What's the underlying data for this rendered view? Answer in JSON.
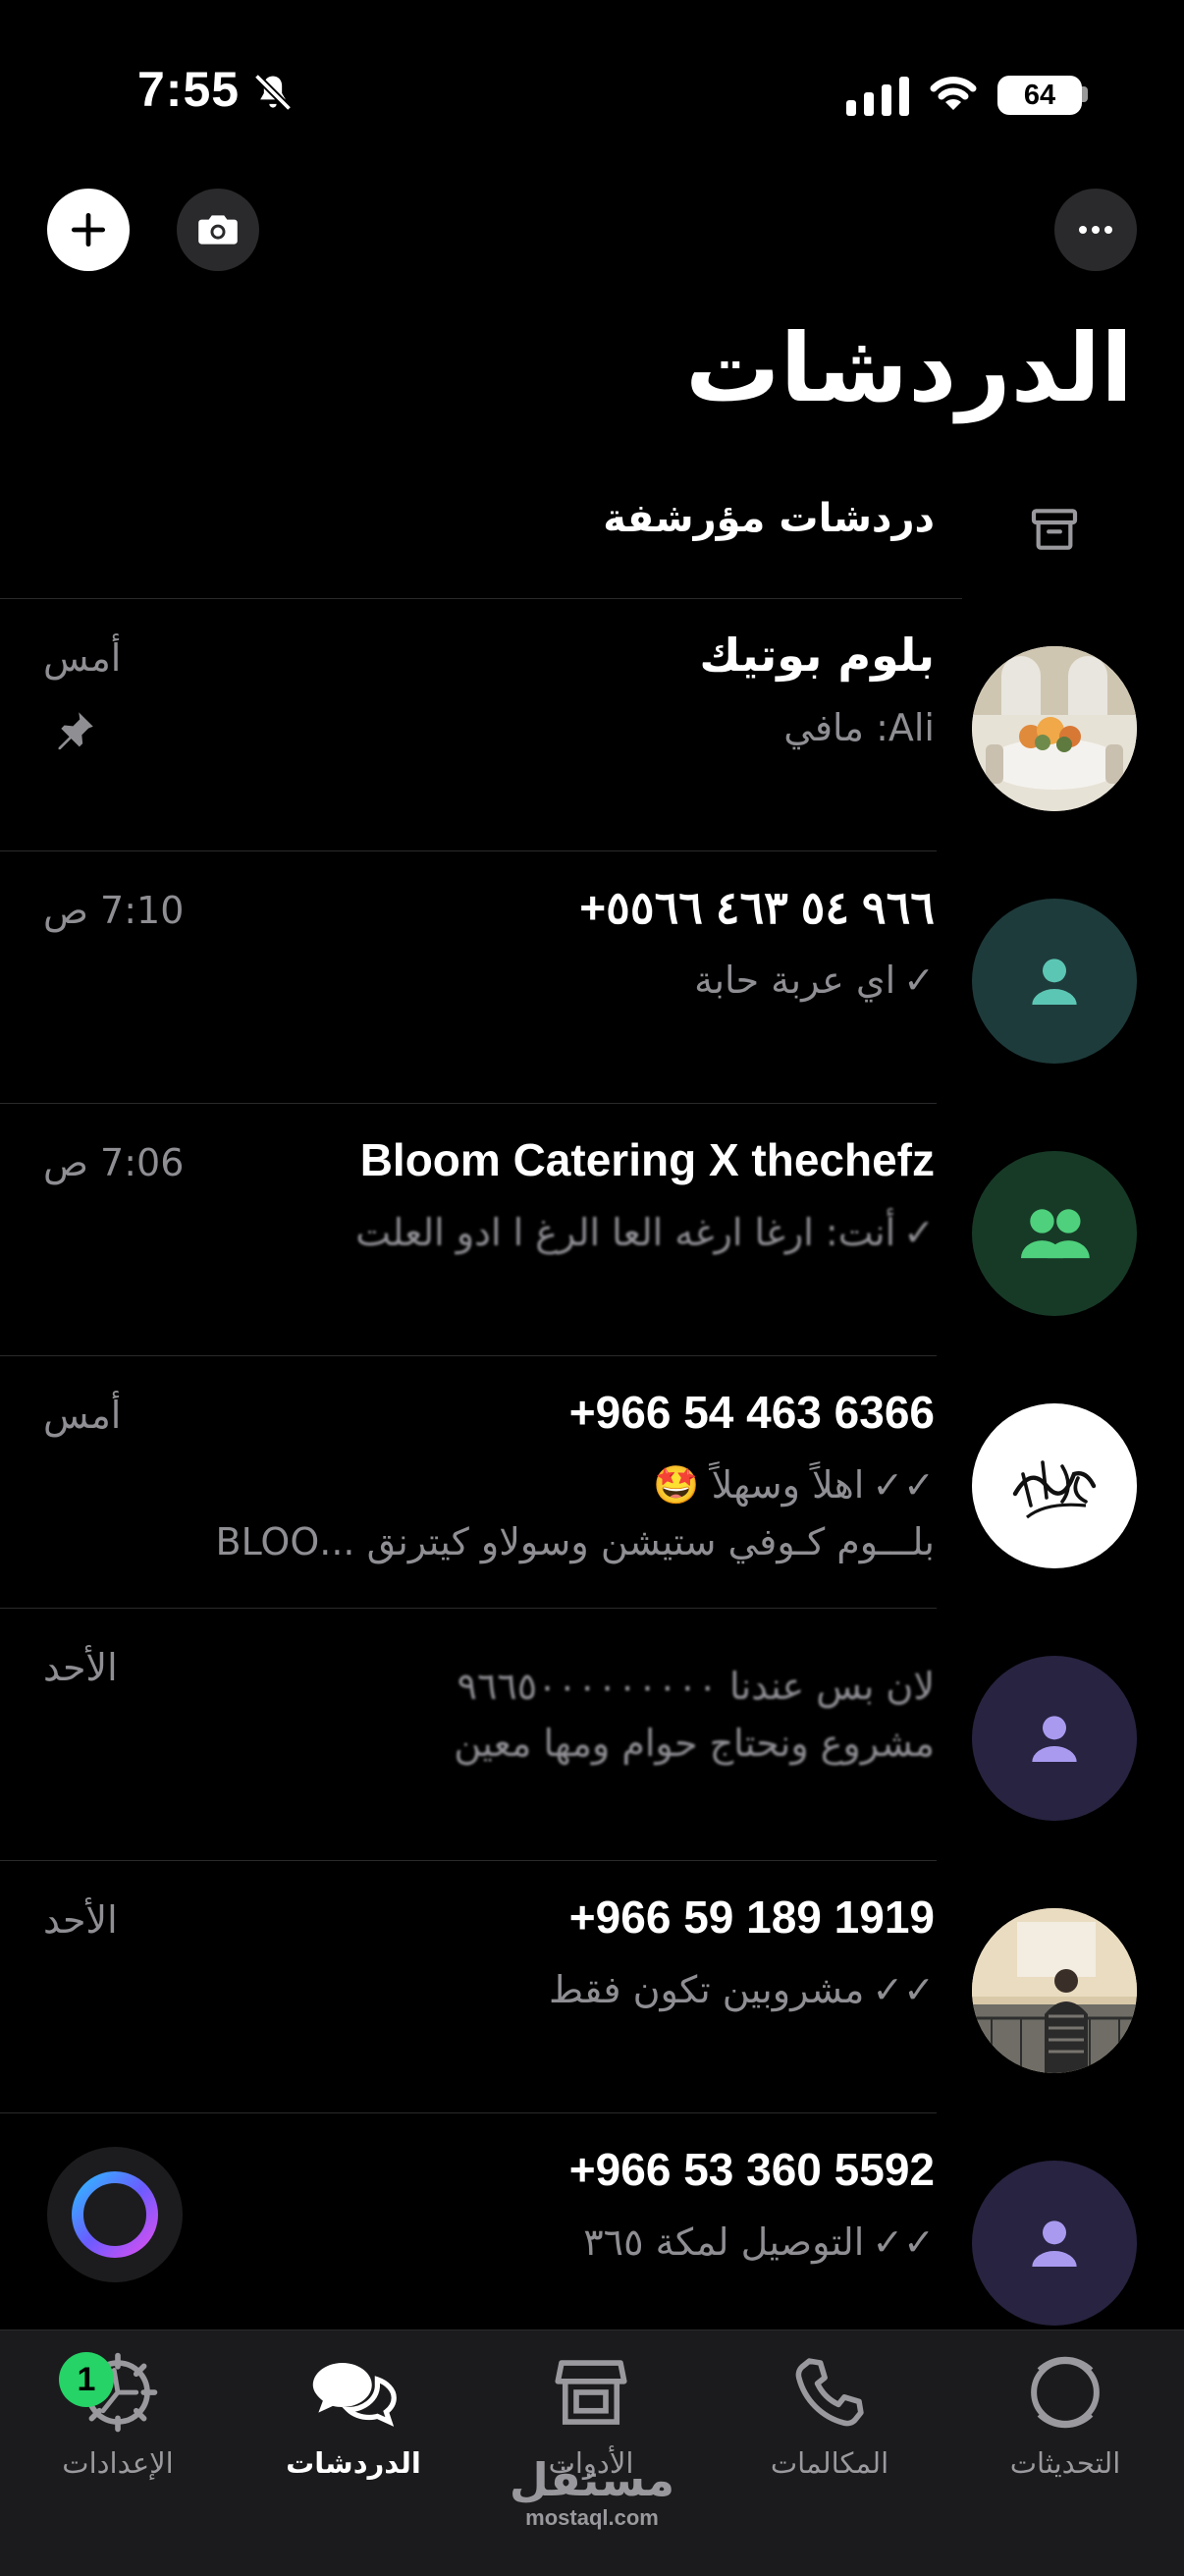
{
  "status_bar": {
    "time": "7:55",
    "battery": "64"
  },
  "header": {
    "title": "الدردشات",
    "new_chat_icon": "plus-icon",
    "camera_icon": "camera-icon",
    "more_icon": "ellipsis-icon"
  },
  "archived": {
    "label": "دردشات مؤرشفة",
    "icon": "archive-box-icon"
  },
  "chats": [
    {
      "name": "بلوم بوتيك",
      "time": "أمس",
      "preview": "Ali: مافي",
      "pinned": true,
      "avatar": "photo",
      "checks": ""
    },
    {
      "name": "+٩٦٦ ٥٤ ٤٦٣ ٥٥٦٦",
      "time": "7:10 ص",
      "preview": "اي عربة حابة",
      "avatar": "person-teal",
      "checks": "✓"
    },
    {
      "name": "Bloom Catering X thechefz",
      "time": "7:06 ص",
      "preview": "أنت: ارغا ارغه العا الرغ ا ادو العلت",
      "avatar": "group-green",
      "checks": "✓"
    },
    {
      "name": "+966 54 463 6366",
      "time": "أمس",
      "preview": "اهلاً وسهلاً 🤩",
      "preview2": "بلـــوم كـوفي ستيشن وسولاو كيترنق ...BLOO",
      "avatar": "calligraphy",
      "checks": "✓✓"
    },
    {
      "name": "",
      "time": "الأحد",
      "preview": "لان بس عندنا ٩٦٦٥٠٠٠٠٠٠٠٠٠",
      "preview2": "مشروع ونحتاج حوام ومها معين",
      "avatar": "person-purple",
      "checks": ""
    },
    {
      "name": "+966 59 189 1919",
      "time": "الأحد",
      "preview": "مشروبين تكون فقط",
      "avatar": "photo-man",
      "checks": "✓✓"
    },
    {
      "name": "+966 53 360 5592",
      "time": "",
      "preview": "التوصيل لمكة ٣٦٥",
      "avatar": "person-purple",
      "checks": "✓✓"
    }
  ],
  "tabs": [
    {
      "label": "التحديثات",
      "icon": "updates-icon"
    },
    {
      "label": "المكالمات",
      "icon": "phone-icon"
    },
    {
      "label": "الأدوات",
      "icon": "store-icon"
    },
    {
      "label": "الدردشات",
      "icon": "chats-icon"
    },
    {
      "label": "الإعدادات",
      "icon": "settings-gear-icon",
      "badge": "1"
    }
  ],
  "watermark": {
    "arabic": "مستقل",
    "latin": "mostaql.com"
  },
  "colors": {
    "background": "#000000",
    "tab_bar": "#1b1b1d",
    "badge": "#25d366",
    "avatar_teal": "#1e3b3b",
    "avatar_green": "#173a27",
    "avatar_purple": "#272340"
  }
}
